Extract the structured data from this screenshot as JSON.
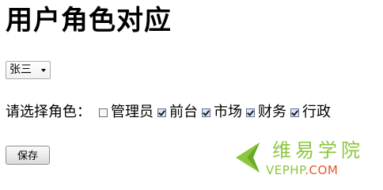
{
  "page": {
    "title": "用户角色对应"
  },
  "user_select": {
    "selected": "张三"
  },
  "roles": {
    "prompt": "请选择角色：",
    "options": [
      {
        "label": "管理员",
        "checked": false
      },
      {
        "label": "前台",
        "checked": true
      },
      {
        "label": "市场",
        "checked": true
      },
      {
        "label": "财务",
        "checked": true
      },
      {
        "label": "行政",
        "checked": true
      }
    ]
  },
  "save_button": {
    "label": "保存"
  },
  "watermark": {
    "name_cn": "维易学院",
    "domain_prefix": "VEPHP",
    "domain_suffix": ".COM",
    "colors": {
      "green": "#8cc63e",
      "orange": "#e8562a"
    }
  }
}
